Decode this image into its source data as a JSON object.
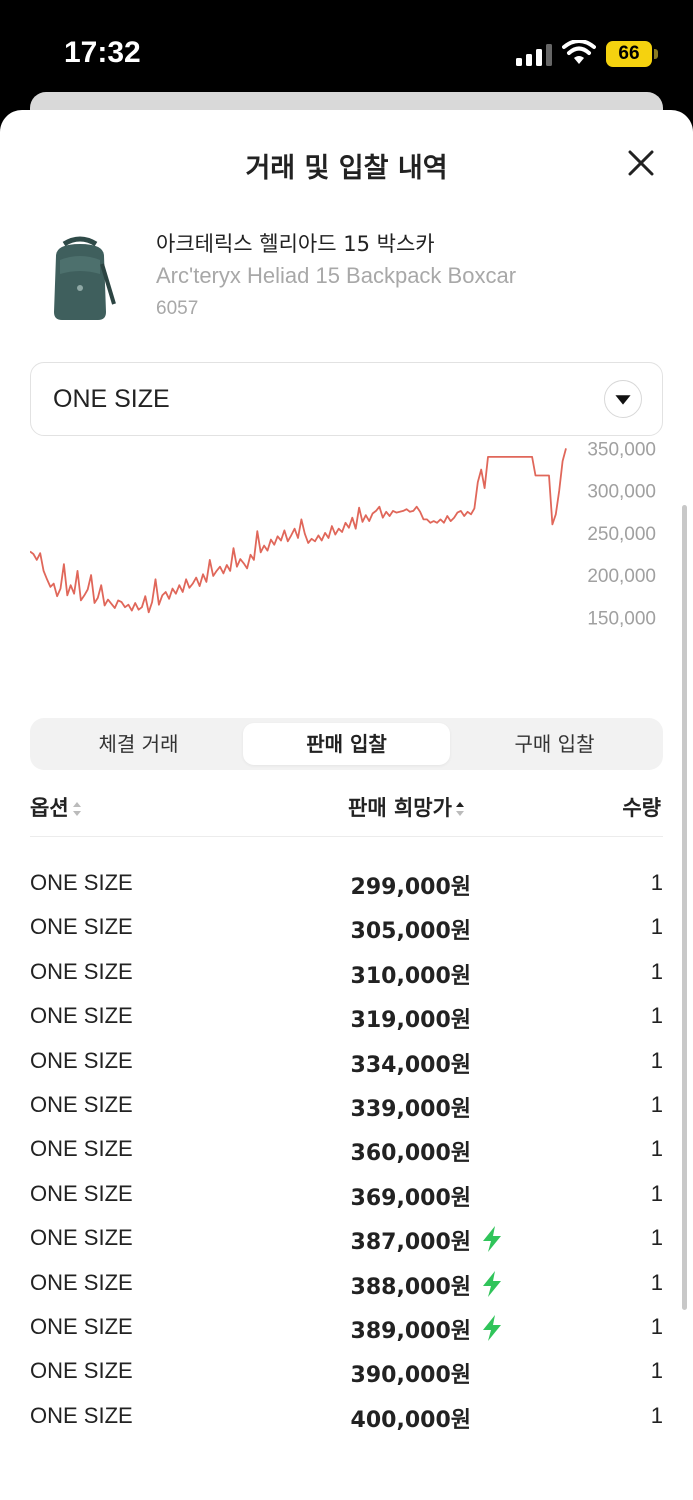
{
  "status_bar": {
    "time": "17:32",
    "battery": "66"
  },
  "sheet": {
    "title": "거래 및 입찰 내역",
    "close_icon": "close-icon"
  },
  "product": {
    "name_ko": "아크테릭스 헬리아드 15 박스카",
    "name_en": "Arc'teryx Heliad 15 Backpack Boxcar",
    "code": "6057"
  },
  "size_select": {
    "value": "ONE SIZE",
    "icon": "dropdown-arrow-icon"
  },
  "chart_data": {
    "type": "line",
    "color": "#e0675a",
    "y_ticks": [
      "350,000",
      "300,000",
      "250,000",
      "200,000",
      "150,000"
    ],
    "ylim": [
      135000,
      360000
    ],
    "values": [
      228000,
      225000,
      218000,
      226000,
      205000,
      195000,
      186000,
      190000,
      175000,
      184000,
      213000,
      176000,
      188000,
      178000,
      205000,
      170000,
      176000,
      183000,
      200000,
      167000,
      173000,
      188000,
      164000,
      171000,
      166000,
      161000,
      170000,
      168000,
      162000,
      165000,
      158000,
      167000,
      159000,
      162000,
      175000,
      156000,
      168000,
      195000,
      165000,
      176000,
      180000,
      172000,
      184000,
      178000,
      188000,
      180000,
      195000,
      185000,
      190000,
      197000,
      187000,
      201000,
      192000,
      218000,
      199000,
      205000,
      210000,
      202000,
      212000,
      205000,
      232000,
      210000,
      219000,
      214000,
      208000,
      224000,
      218000,
      252000,
      227000,
      235000,
      229000,
      242000,
      236000,
      246000,
      241000,
      253000,
      240000,
      247000,
      255000,
      244000,
      266000,
      249000,
      238000,
      243000,
      240000,
      247000,
      241000,
      250000,
      244000,
      258000,
      248000,
      255000,
      251000,
      262000,
      256000,
      268000,
      255000,
      280000,
      263000,
      271000,
      264000,
      273000,
      276000,
      281000,
      268000,
      275000,
      270000,
      276000,
      274000,
      275000,
      276000,
      278000,
      275000,
      276000,
      281000,
      275000,
      266000,
      266000,
      262000,
      264000,
      262000,
      266000,
      262000,
      270000,
      264000,
      268000,
      274000,
      276000,
      270000,
      275000,
      272000,
      279000,
      310000,
      325000,
      303000,
      340000,
      340000,
      340000,
      340000,
      340000,
      340000,
      340000,
      340000,
      340000,
      340000,
      340000,
      340000,
      340000,
      340000,
      318000,
      318000,
      318000,
      318000,
      318000,
      260000,
      272000,
      300000,
      335000,
      350000
    ]
  },
  "tabs": [
    {
      "label": "체결 거래",
      "active": false
    },
    {
      "label": "판매 입찰",
      "active": true
    },
    {
      "label": "구매 입찰",
      "active": false
    }
  ],
  "table": {
    "headers": {
      "option": "옵션",
      "price": "판매 희망가",
      "qty": "수량"
    },
    "rows": [
      {
        "size": "ONE SIZE",
        "price": "299,000원",
        "qty": "1",
        "bolt": false
      },
      {
        "size": "ONE SIZE",
        "price": "305,000원",
        "qty": "1",
        "bolt": false
      },
      {
        "size": "ONE SIZE",
        "price": "310,000원",
        "qty": "1",
        "bolt": false
      },
      {
        "size": "ONE SIZE",
        "price": "319,000원",
        "qty": "1",
        "bolt": false
      },
      {
        "size": "ONE SIZE",
        "price": "334,000원",
        "qty": "1",
        "bolt": false
      },
      {
        "size": "ONE SIZE",
        "price": "339,000원",
        "qty": "1",
        "bolt": false
      },
      {
        "size": "ONE SIZE",
        "price": "360,000원",
        "qty": "1",
        "bolt": false
      },
      {
        "size": "ONE SIZE",
        "price": "369,000원",
        "qty": "1",
        "bolt": false
      },
      {
        "size": "ONE SIZE",
        "price": "387,000원",
        "qty": "1",
        "bolt": true
      },
      {
        "size": "ONE SIZE",
        "price": "388,000원",
        "qty": "1",
        "bolt": true
      },
      {
        "size": "ONE SIZE",
        "price": "389,000원",
        "qty": "1",
        "bolt": true
      },
      {
        "size": "ONE SIZE",
        "price": "390,000원",
        "qty": "1",
        "bolt": false
      },
      {
        "size": "ONE SIZE",
        "price": "400,000원",
        "qty": "1",
        "bolt": false
      }
    ]
  }
}
